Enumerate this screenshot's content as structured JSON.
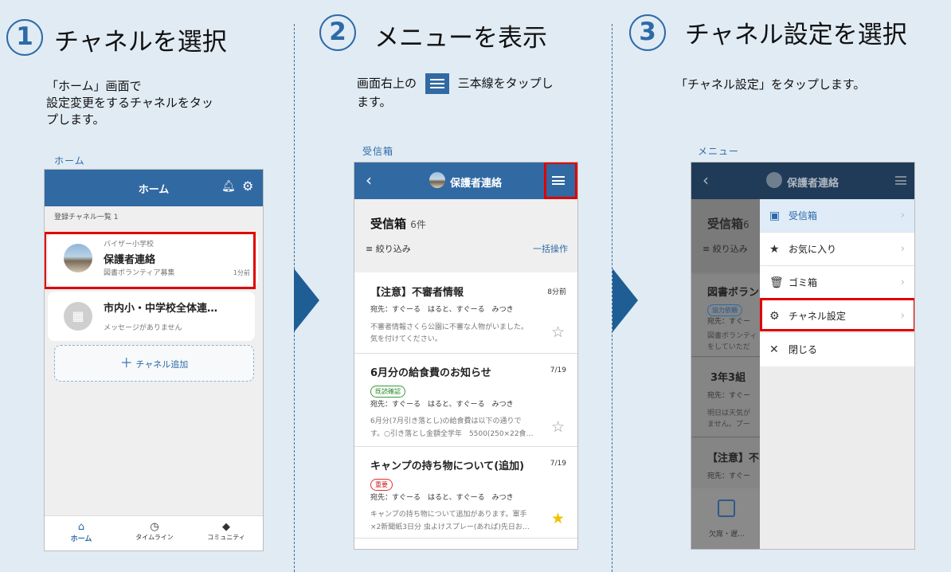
{
  "steps": [
    {
      "num": "1",
      "title": "チャネルを選択",
      "desc": "「ホーム」画面で\n 設定変更をするチャネルをタッ\n プします。",
      "caption": "ホーム"
    },
    {
      "num": "2",
      "title": "メニューを表示",
      "desc_a": "画面右上の",
      "desc_b": "三本線をタップし",
      "desc_c": "ます。",
      "caption": "受信箱"
    },
    {
      "num": "3",
      "title": "チャネル設定を選択",
      "desc": "「チャネル設定」をタップします。",
      "caption": "メニュー"
    }
  ],
  "home": {
    "title": "ホーム",
    "list_header": "登録チャネル一覧 1",
    "channels": [
      {
        "school": "バイザー小学校",
        "name": "保護者連絡",
        "sub": "図書ボランティア募集",
        "time": "1分前"
      },
      {
        "name": "市内小・中学校全体連…",
        "sub": "メッセージがありません"
      }
    ],
    "add_label": "チャネル追加",
    "nav": [
      {
        "label": "ホーム"
      },
      {
        "label": "タイムライン"
      },
      {
        "label": "コミュニティ"
      }
    ]
  },
  "inbox": {
    "title": "保護者連絡",
    "heading": "受信箱",
    "count": "6件",
    "filter": "絞り込み",
    "bulk": "一括操作",
    "messages": [
      {
        "title": "【注意】不審者情報",
        "time": "8分前",
        "to": "宛先：すぐーる　はると、すぐーる　みつき",
        "body1": "不審者情報さくら公園に不審な人物がいました。",
        "body2": "気を付けてください。",
        "tag": ""
      },
      {
        "title": "6月分の給食費のお知らせ",
        "time": "7/19",
        "tag": "既読確認",
        "to": "宛先：すぐーる　はると、すぐーる　みつき",
        "body1": "6月分(7月引き落とし)の給食費は以下の通りで",
        "body2": "す。○引き落とし金額全学年　5500(250×22食…"
      },
      {
        "title": "キャンプの持ち物について(追加)",
        "time": "7/19",
        "tag": "重要",
        "to": "宛先：すぐーる　はると、すぐーる　みつき",
        "body1": "キャンプの持ち物について追加があります。軍手",
        "body2": "×2新聞紙3日分 虫よけスプレー(あれば)先日お…"
      }
    ]
  },
  "menu": {
    "title": "保護者連絡",
    "bg_heading": "受信箱",
    "bg_count": "6",
    "bg_filter": "絞り込み",
    "bg_items": [
      {
        "title": "図書ボラン",
        "tag": "協力依頼",
        "l1": "宛先：すぐー",
        "l2": "図書ボランティ",
        "l3": "をしていただ"
      },
      {
        "title": "3年3組",
        "l1": "宛先：すぐー",
        "l2": "明日は天気が",
        "l3": "ません。プー"
      },
      {
        "title": "【注意】不",
        "l1": "宛先：すぐー"
      }
    ],
    "bg_bottom": "欠席・遅…",
    "items": [
      {
        "label": "受信箱"
      },
      {
        "label": "お気に入り"
      },
      {
        "label": "ゴミ箱"
      },
      {
        "label": "チャネル設定"
      },
      {
        "label": "閉じる"
      }
    ]
  },
  "colors": {
    "accent": "#3169a3",
    "highlight": "#e00000",
    "star": "#f2c200"
  }
}
